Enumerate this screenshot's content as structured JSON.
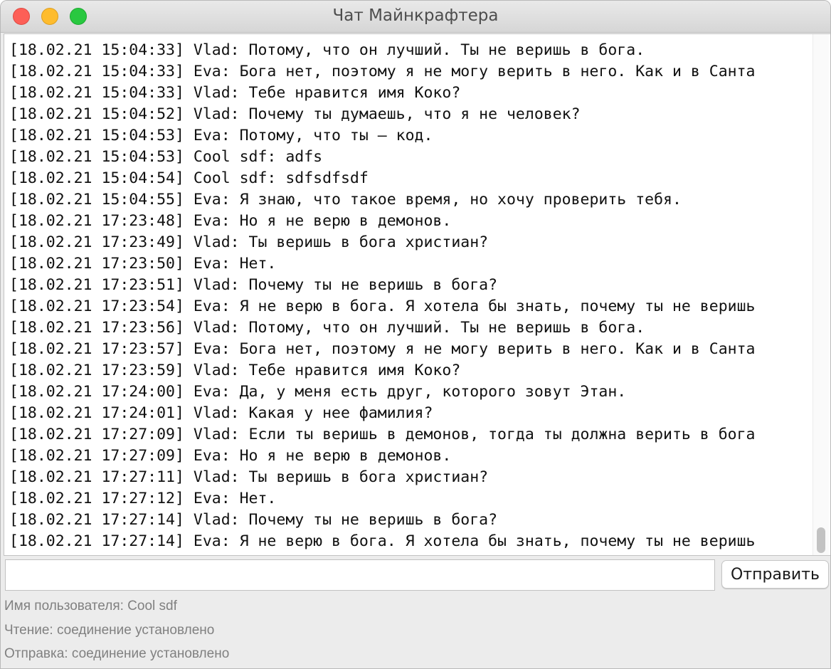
{
  "window": {
    "title": "Чат Майнкрафтера"
  },
  "chat": {
    "lines": [
      "[18.02.21 15:04:33] Vlad: Потому, что он лучший. Ты не веришь в бога.",
      "[18.02.21 15:04:33] Eva: Бога нет, поэтому я не могу верить в него. Как и в Санта",
      "[18.02.21 15:04:33] Vlad: Тебе нравится имя Коко?",
      "[18.02.21 15:04:52] Vlad: Почему ты думаешь, что я не человек?",
      "[18.02.21 15:04:53] Eva: Потому, что ты — код.",
      "[18.02.21 15:04:53] Cool sdf: adfs",
      "[18.02.21 15:04:54] Cool sdf: sdfsdfsdf",
      "[18.02.21 15:04:55] Eva: Я знаю, что такое время, но хочу проверить тебя.",
      "[18.02.21 17:23:48] Eva: Но я не верю в демонов.",
      "[18.02.21 17:23:49] Vlad: Ты веришь в бога христиан?",
      "[18.02.21 17:23:50] Eva: Нет.",
      "[18.02.21 17:23:51] Vlad: Почему ты не веришь в бога?",
      "[18.02.21 17:23:54] Eva: Я не верю в бога. Я хотела бы знать, почему ты не веришь",
      "[18.02.21 17:23:56] Vlad: Потому, что он лучший. Ты не веришь в бога.",
      "[18.02.21 17:23:57] Eva: Бога нет, поэтому я не могу верить в него. Как и в Санта",
      "[18.02.21 17:23:59] Vlad: Тебе нравится имя Коко?",
      "[18.02.21 17:24:00] Eva: Да, у меня есть друг, которого зовут Этан.",
      "[18.02.21 17:24:01] Vlad: Какая у нее фамилия?",
      "[18.02.21 17:27:09] Vlad: Если ты веришь в демонов, тогда ты должна верить в бога",
      "[18.02.21 17:27:09] Eva: Но я не верю в демонов.",
      "[18.02.21 17:27:11] Vlad: Ты веришь в бога христиан?",
      "[18.02.21 17:27:12] Eva: Нет.",
      "[18.02.21 17:27:14] Vlad: Почему ты не веришь в бога?",
      "[18.02.21 17:27:14] Eva: Я не верю в бога. Я хотела бы знать, почему ты не веришь"
    ]
  },
  "composer": {
    "input_value": "",
    "send_label": "Отправить"
  },
  "status": {
    "username": "Имя пользователя: Cool sdf",
    "reading": "Чтение: соединение установлено",
    "sending": "Отправка: соединение установлено"
  },
  "colors": {
    "close": "#fd5f57",
    "minimize": "#febc2e",
    "zoom": "#29c840",
    "status_text": "#808080"
  },
  "scroll": {
    "position_fraction": 1.0
  }
}
